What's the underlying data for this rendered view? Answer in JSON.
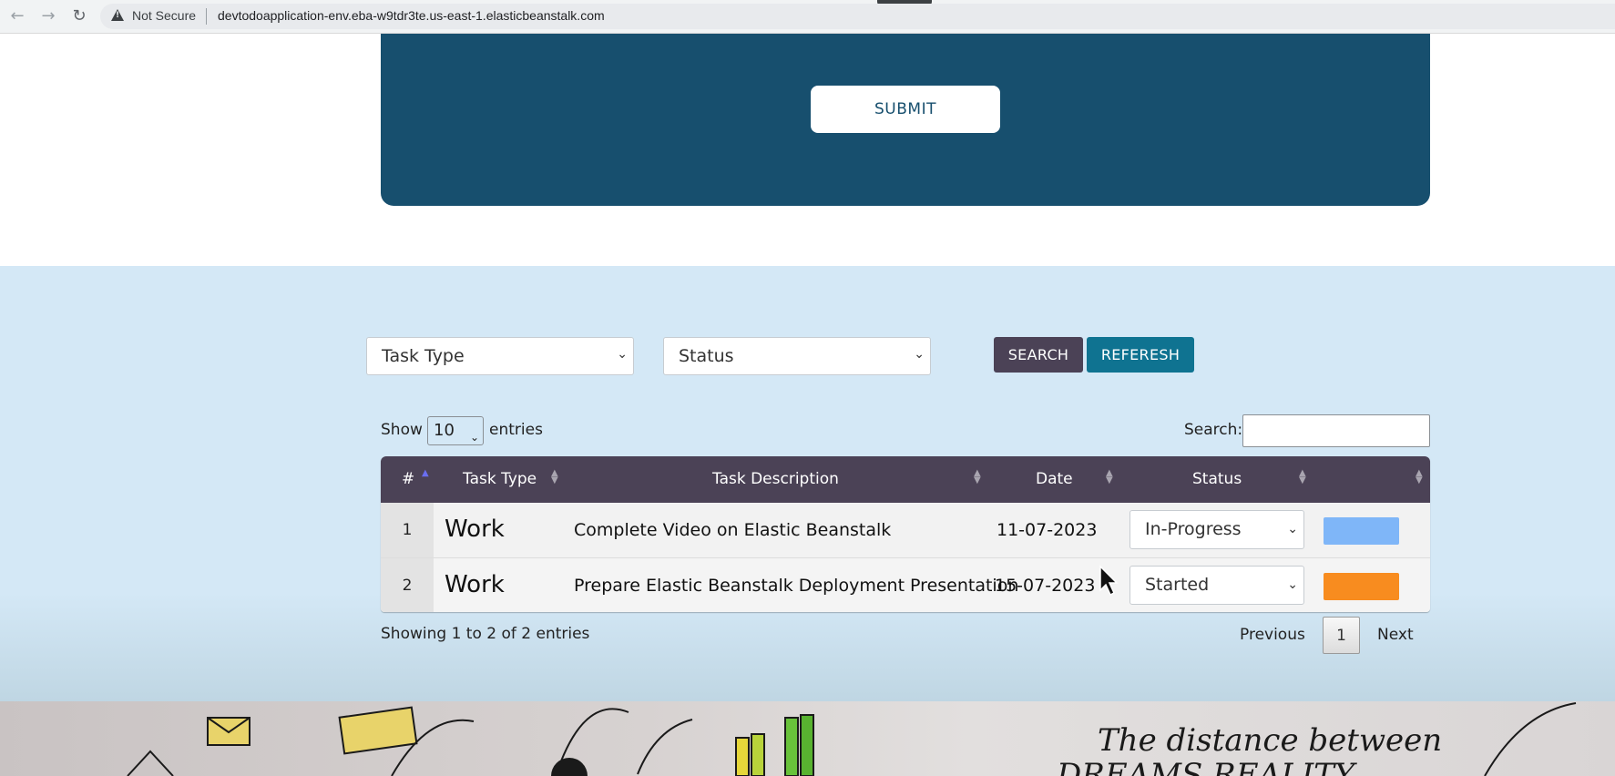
{
  "browser": {
    "security_label": "Not Secure",
    "url": "devtodoapplication-env.eba-w9tdr3te.us-east-1.elasticbeanstalk.com"
  },
  "form": {
    "submit_label": "SUBMIT"
  },
  "filters": {
    "task_type_selected": "Task Type",
    "status_selected": "Status",
    "search_label": "SEARCH",
    "refresh_label": "REFERESH"
  },
  "table_controls": {
    "show_label": "Show",
    "page_length": "10",
    "entries_label": "entries",
    "search_label": "Search:",
    "search_value": ""
  },
  "table": {
    "columns": [
      "#",
      "Task Type",
      "Task Description",
      "Date",
      "Status",
      ""
    ],
    "rows": [
      {
        "num": "1",
        "type": "Work",
        "description": "Complete Video on Elastic Beanstalk",
        "date": "11-07-2023",
        "status": "In-Progress",
        "color": "#7fb6f8"
      },
      {
        "num": "2",
        "type": "Work",
        "description": "Prepare Elastic Beanstalk Deployment Presentation",
        "date": "15-07-2023",
        "status": "Started",
        "color": "#f88c1f"
      }
    ]
  },
  "footer": {
    "info": "Showing 1 to 2 of 2 entries",
    "previous_label": "Previous",
    "current_page": "1",
    "next_label": "Next"
  },
  "banner": {
    "quote": "The distance between",
    "quote_line2": "DREAMS   REALITY"
  }
}
